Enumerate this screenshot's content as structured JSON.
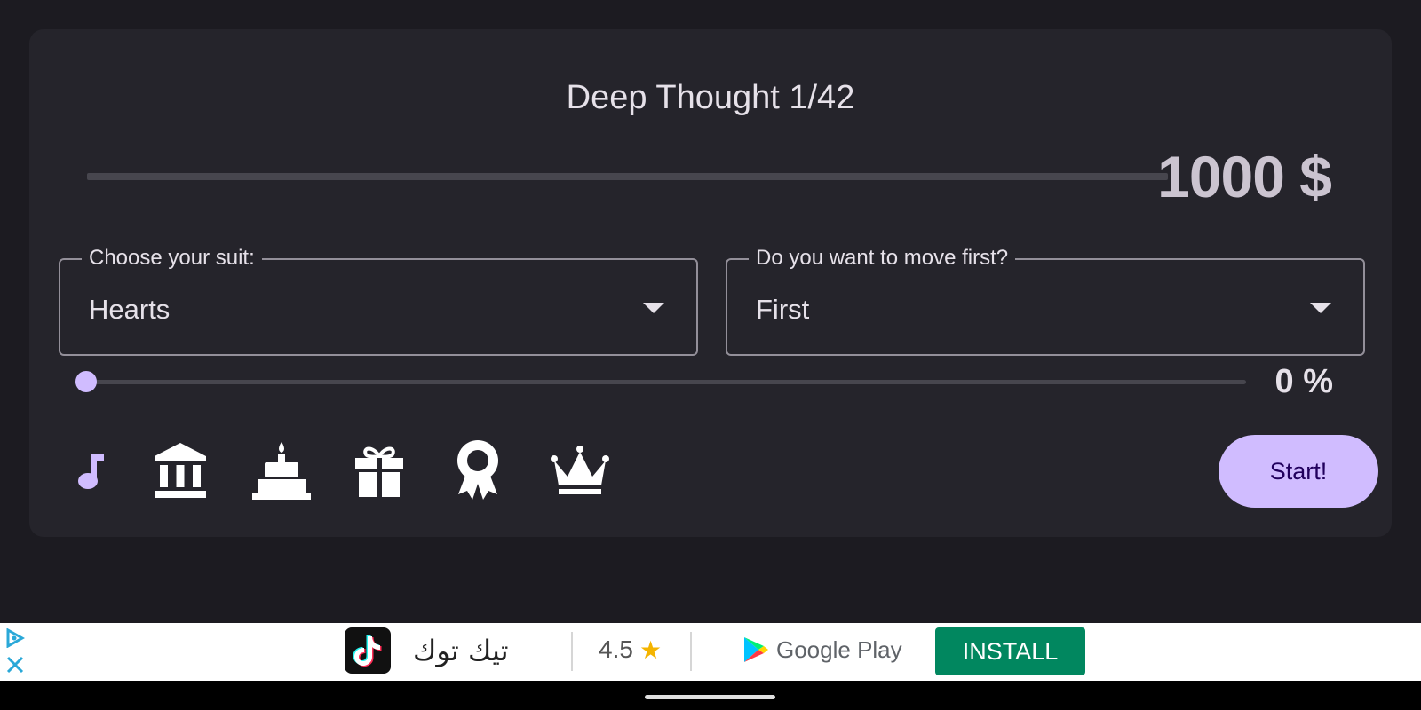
{
  "app": {
    "title": "Deep Thought 1/42",
    "balance": "1000 $",
    "balance_progress": 0
  },
  "suit_select": {
    "label": "Choose your suit:",
    "value": "Hearts"
  },
  "move_select": {
    "label": "Do you want to move first?",
    "value": "First"
  },
  "slider": {
    "value_percent": 0,
    "label": "0 %"
  },
  "icons": [
    "music-note-icon",
    "bank-icon",
    "cake-icon",
    "gift-icon",
    "award-ribbon-icon",
    "crown-icon"
  ],
  "start_button": "Start!",
  "ad": {
    "app_name": "تيك توك",
    "rating": "4.5",
    "store": "Google Play",
    "install_label": "INSTALL"
  },
  "colors": {
    "accent": "#d0bcff",
    "background": "#1c1b21",
    "card": "#25242b",
    "install": "#01875f"
  }
}
